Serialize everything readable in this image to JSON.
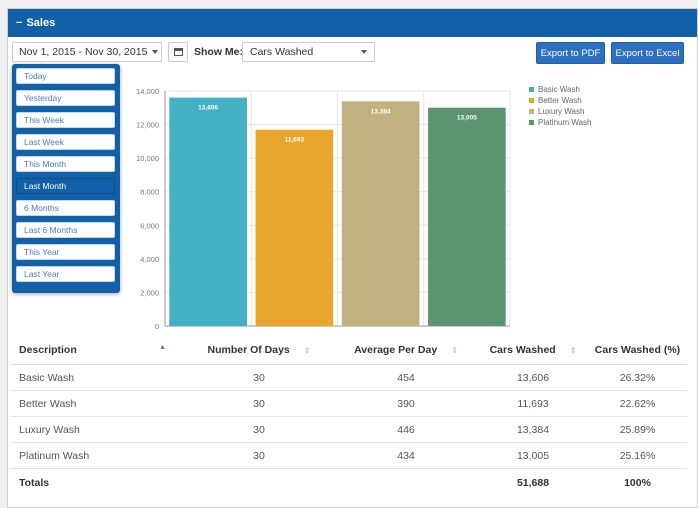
{
  "panel": {
    "title": "Sales",
    "collapse_symbol": "−"
  },
  "toolbar": {
    "date_range": "Nov 1, 2015 - Nov 30, 2015",
    "show_me_label": "Show Me:",
    "metric": "Cars Washed",
    "export_pdf": "Export to PDF",
    "export_excel": "Export to Excel"
  },
  "range_menu": {
    "items": [
      "Today",
      "Yesterday",
      "This Week",
      "Last Week",
      "This Month",
      "Last Month",
      "6 Months",
      "Last 6 Months",
      "This Year",
      "Last Year"
    ],
    "active": "Last Month"
  },
  "chart_data": {
    "type": "bar",
    "categories": [
      "Basic Wash",
      "Better Wash",
      "Luxury Wash",
      "Platinum Wash"
    ],
    "values": [
      13606,
      11693,
      13384,
      13005
    ],
    "data_labels": [
      "13,606",
      "11,693",
      "13,384",
      "13,005"
    ],
    "ylim": [
      0,
      14000
    ],
    "yticks": [
      "0",
      "2,000",
      "4,000",
      "6,000",
      "8,000",
      "10,000",
      "12,000",
      "14,000"
    ],
    "colors": [
      "#44b0c6",
      "#e8a72c",
      "#c0b17f",
      "#5a9470"
    ],
    "legend": "right",
    "grid": true
  },
  "table": {
    "headers": [
      "Description",
      "Number Of Days",
      "Average Per Day",
      "Cars Washed",
      "Cars Washed (%)"
    ],
    "rows": [
      [
        "Basic Wash",
        "30",
        "454",
        "13,606",
        "26.32%"
      ],
      [
        "Better Wash",
        "30",
        "390",
        "11,693",
        "22.62%"
      ],
      [
        "Luxury Wash",
        "30",
        "446",
        "13,384",
        "25.89%"
      ],
      [
        "Platinum Wash",
        "30",
        "434",
        "13,005",
        "25.16%"
      ]
    ],
    "totals": [
      "Totals",
      "",
      "",
      "51,688",
      "100%"
    ]
  },
  "icons": {
    "sort_asc": "▲",
    "sort_neutral": "⇕",
    "calendar": "calendar-icon"
  }
}
